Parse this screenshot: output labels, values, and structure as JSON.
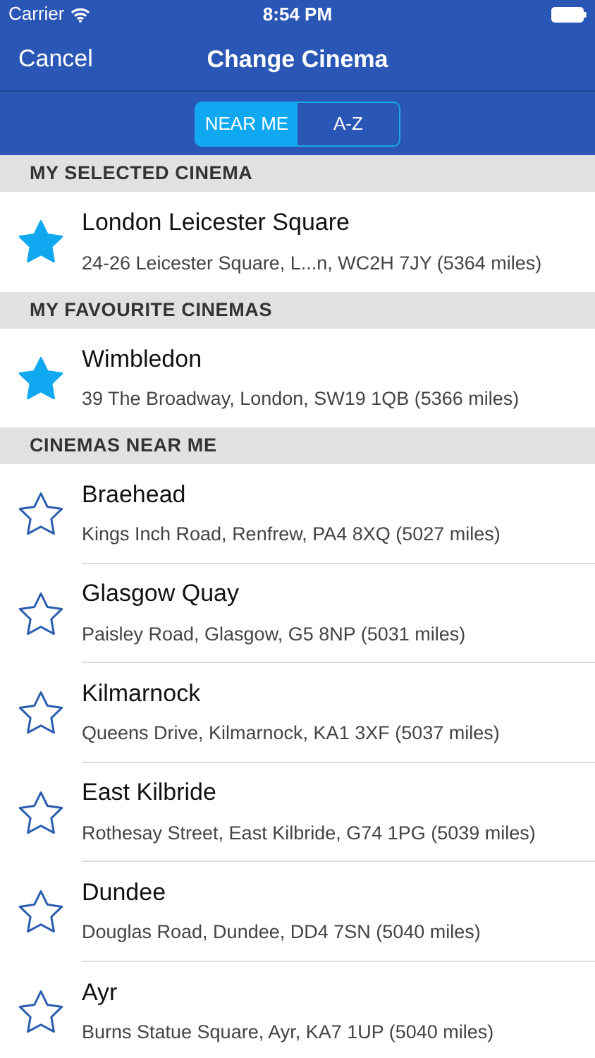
{
  "status_bar": {
    "carrier": "Carrier",
    "time": "8:54 PM"
  },
  "nav": {
    "left_button": "Cancel",
    "title": "Change Cinema"
  },
  "segments": [
    {
      "label": "NEAR ME",
      "selected": true
    },
    {
      "label": "A-Z",
      "selected": false
    }
  ],
  "sections": [
    {
      "header": "MY SELECTED CINEMA",
      "rows": [
        {
          "name": "London Leicester Square",
          "address": "24-26 Leicester Square, L...n, WC2H 7JY (5364 miles)",
          "starred": true
        }
      ]
    },
    {
      "header": "MY FAVOURITE CINEMAS",
      "rows": [
        {
          "name": "Wimbledon",
          "address": "39 The Broadway, London, SW19 1QB (5366 miles)",
          "starred": true
        }
      ]
    },
    {
      "header": "CINEMAS NEAR ME",
      "rows": [
        {
          "name": "Braehead",
          "address": "Kings Inch Road, Renfrew, PA4 8XQ (5027 miles)",
          "starred": false
        },
        {
          "name": "Glasgow Quay",
          "address": "Paisley Road, Glasgow, G5 8NP (5031 miles)",
          "starred": false
        },
        {
          "name": "Kilmarnock",
          "address": "Queens Drive, Kilmarnock, KA1 3XF (5037 miles)",
          "starred": false
        },
        {
          "name": "East Kilbride",
          "address": "Rothesay Street, East Kilbride, G74 1PG (5039 miles)",
          "starred": false
        },
        {
          "name": "Dundee",
          "address": "Douglas Road, Dundee, DD4 7SN (5040 miles)",
          "starred": false
        },
        {
          "name": "Ayr",
          "address": "Burns Statue Square, Ayr, KA7 1UP (5040 miles)",
          "starred": false
        }
      ]
    }
  ]
}
